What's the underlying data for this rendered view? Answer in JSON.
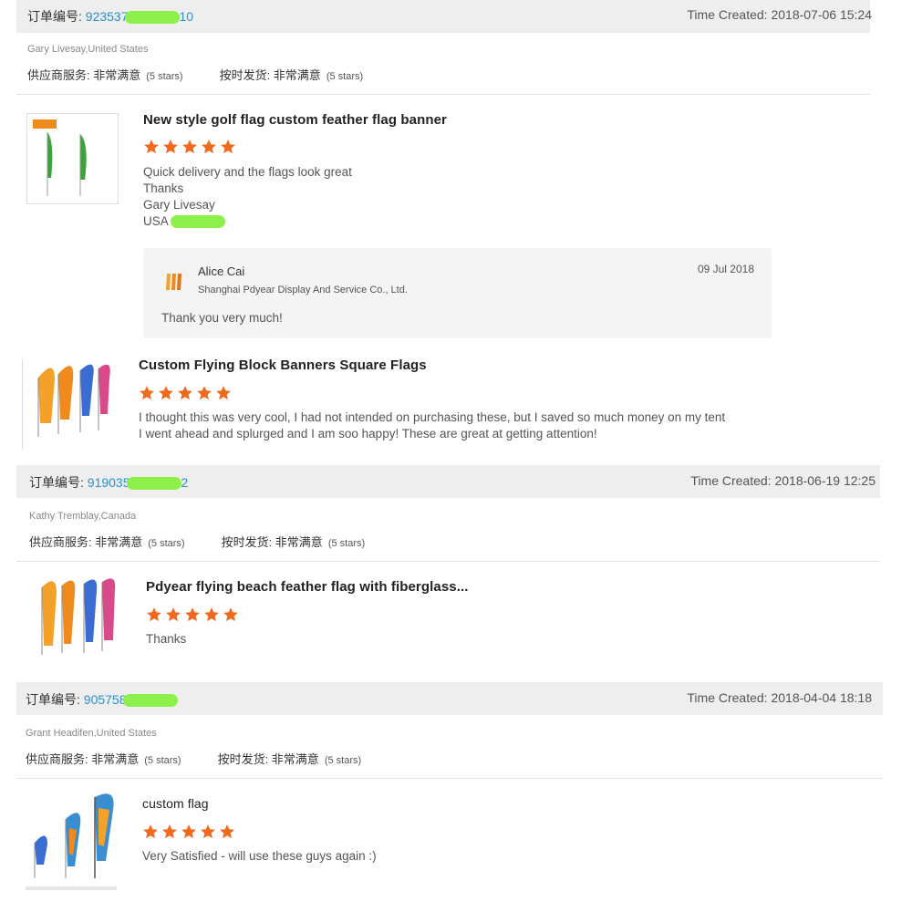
{
  "orders": [
    {
      "order_label": "订单编号:",
      "order_number": "923537",
      "order_tail": "10",
      "time_created": "Time Created: 2018-07-06 15:24",
      "buyer": "Gary Livesay,United States",
      "supplier_service_label": "供应商服务: 非常满意",
      "supplier_service_stars": "(5 stars)",
      "on_time_label": "按时发货: 非常满意",
      "on_time_stars": "(5 stars)",
      "products": [
        {
          "title": "New style golf flag custom feather flag banner",
          "rating": 5,
          "review_lines": [
            "Quick delivery and the flags look great",
            "Thanks",
            "Gary Livesay",
            "USA"
          ],
          "reply": {
            "name": "Alice Cai",
            "company": "Shanghai Pdyear Display And Service Co., Ltd.",
            "date": "09 Jul 2018",
            "text": "Thank you very much!"
          }
        },
        {
          "title": "Custom Flying Block Banners Square Flags",
          "rating": 5,
          "review_lines": [
            "I thought this was very cool, I had not intended on purchasing these, but I saved so much money on my tent",
            "I went ahead and splurged and I am soo happy! These are great at getting attention!"
          ]
        }
      ]
    },
    {
      "order_label": "订单编号:",
      "order_number": "919035",
      "order_tail": "2",
      "time_created": "Time Created: 2018-06-19 12:25",
      "buyer": "Kathy Tremblay,Canada",
      "supplier_service_label": "供应商服务: 非常满意",
      "supplier_service_stars": "(5 stars)",
      "on_time_label": "按时发货: 非常满意",
      "on_time_stars": "(5 stars)",
      "products": [
        {
          "title": "Pdyear flying beach feather flag with fiberglass...",
          "rating": 5,
          "review_lines": [
            "Thanks"
          ]
        }
      ]
    },
    {
      "order_label": "订单编号:",
      "order_number": "905758",
      "order_tail": "",
      "time_created": "Time Created: 2018-04-04 18:18",
      "buyer": "Grant Headifen,United States",
      "supplier_service_label": "供应商服务: 非常满意",
      "supplier_service_stars": "(5 stars)",
      "on_time_label": "按时发货: 非常满意",
      "on_time_stars": "(5 stars)",
      "products": [
        {
          "title": "custom flag",
          "rating": 5,
          "review_lines": [
            "Very Satisfied - will use these guys again :)"
          ]
        }
      ]
    }
  ],
  "colors": {
    "star": "#f06a1e",
    "link": "#2a8fd0",
    "bar": "#eeeeee",
    "redaction": "#8ef04a"
  },
  "icons": {
    "star": "star-icon",
    "logo": "company-logo-icon"
  }
}
